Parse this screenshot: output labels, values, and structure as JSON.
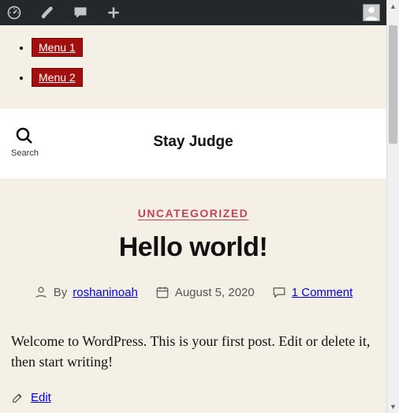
{
  "adminbar": {
    "icons": {
      "dashboard": "dashboard-icon",
      "customize": "brush-icon",
      "comments": "comment-icon",
      "new": "plus-icon",
      "profile": "avatar-icon"
    }
  },
  "nav": {
    "items": [
      {
        "label": "Menu 1"
      },
      {
        "label": "Menu 2"
      }
    ]
  },
  "header": {
    "search_label": "Search",
    "site_title": "Stay Judge"
  },
  "post": {
    "category": "UNCATEGORIZED",
    "title": "Hello world!",
    "author_prefix": "By",
    "author": "roshaninoah",
    "date": "August 5, 2020",
    "comments": "1 Comment",
    "body": "Welcome to WordPress. This is your first post. Edit or delete it, then start writing!",
    "edit_label": "Edit"
  }
}
